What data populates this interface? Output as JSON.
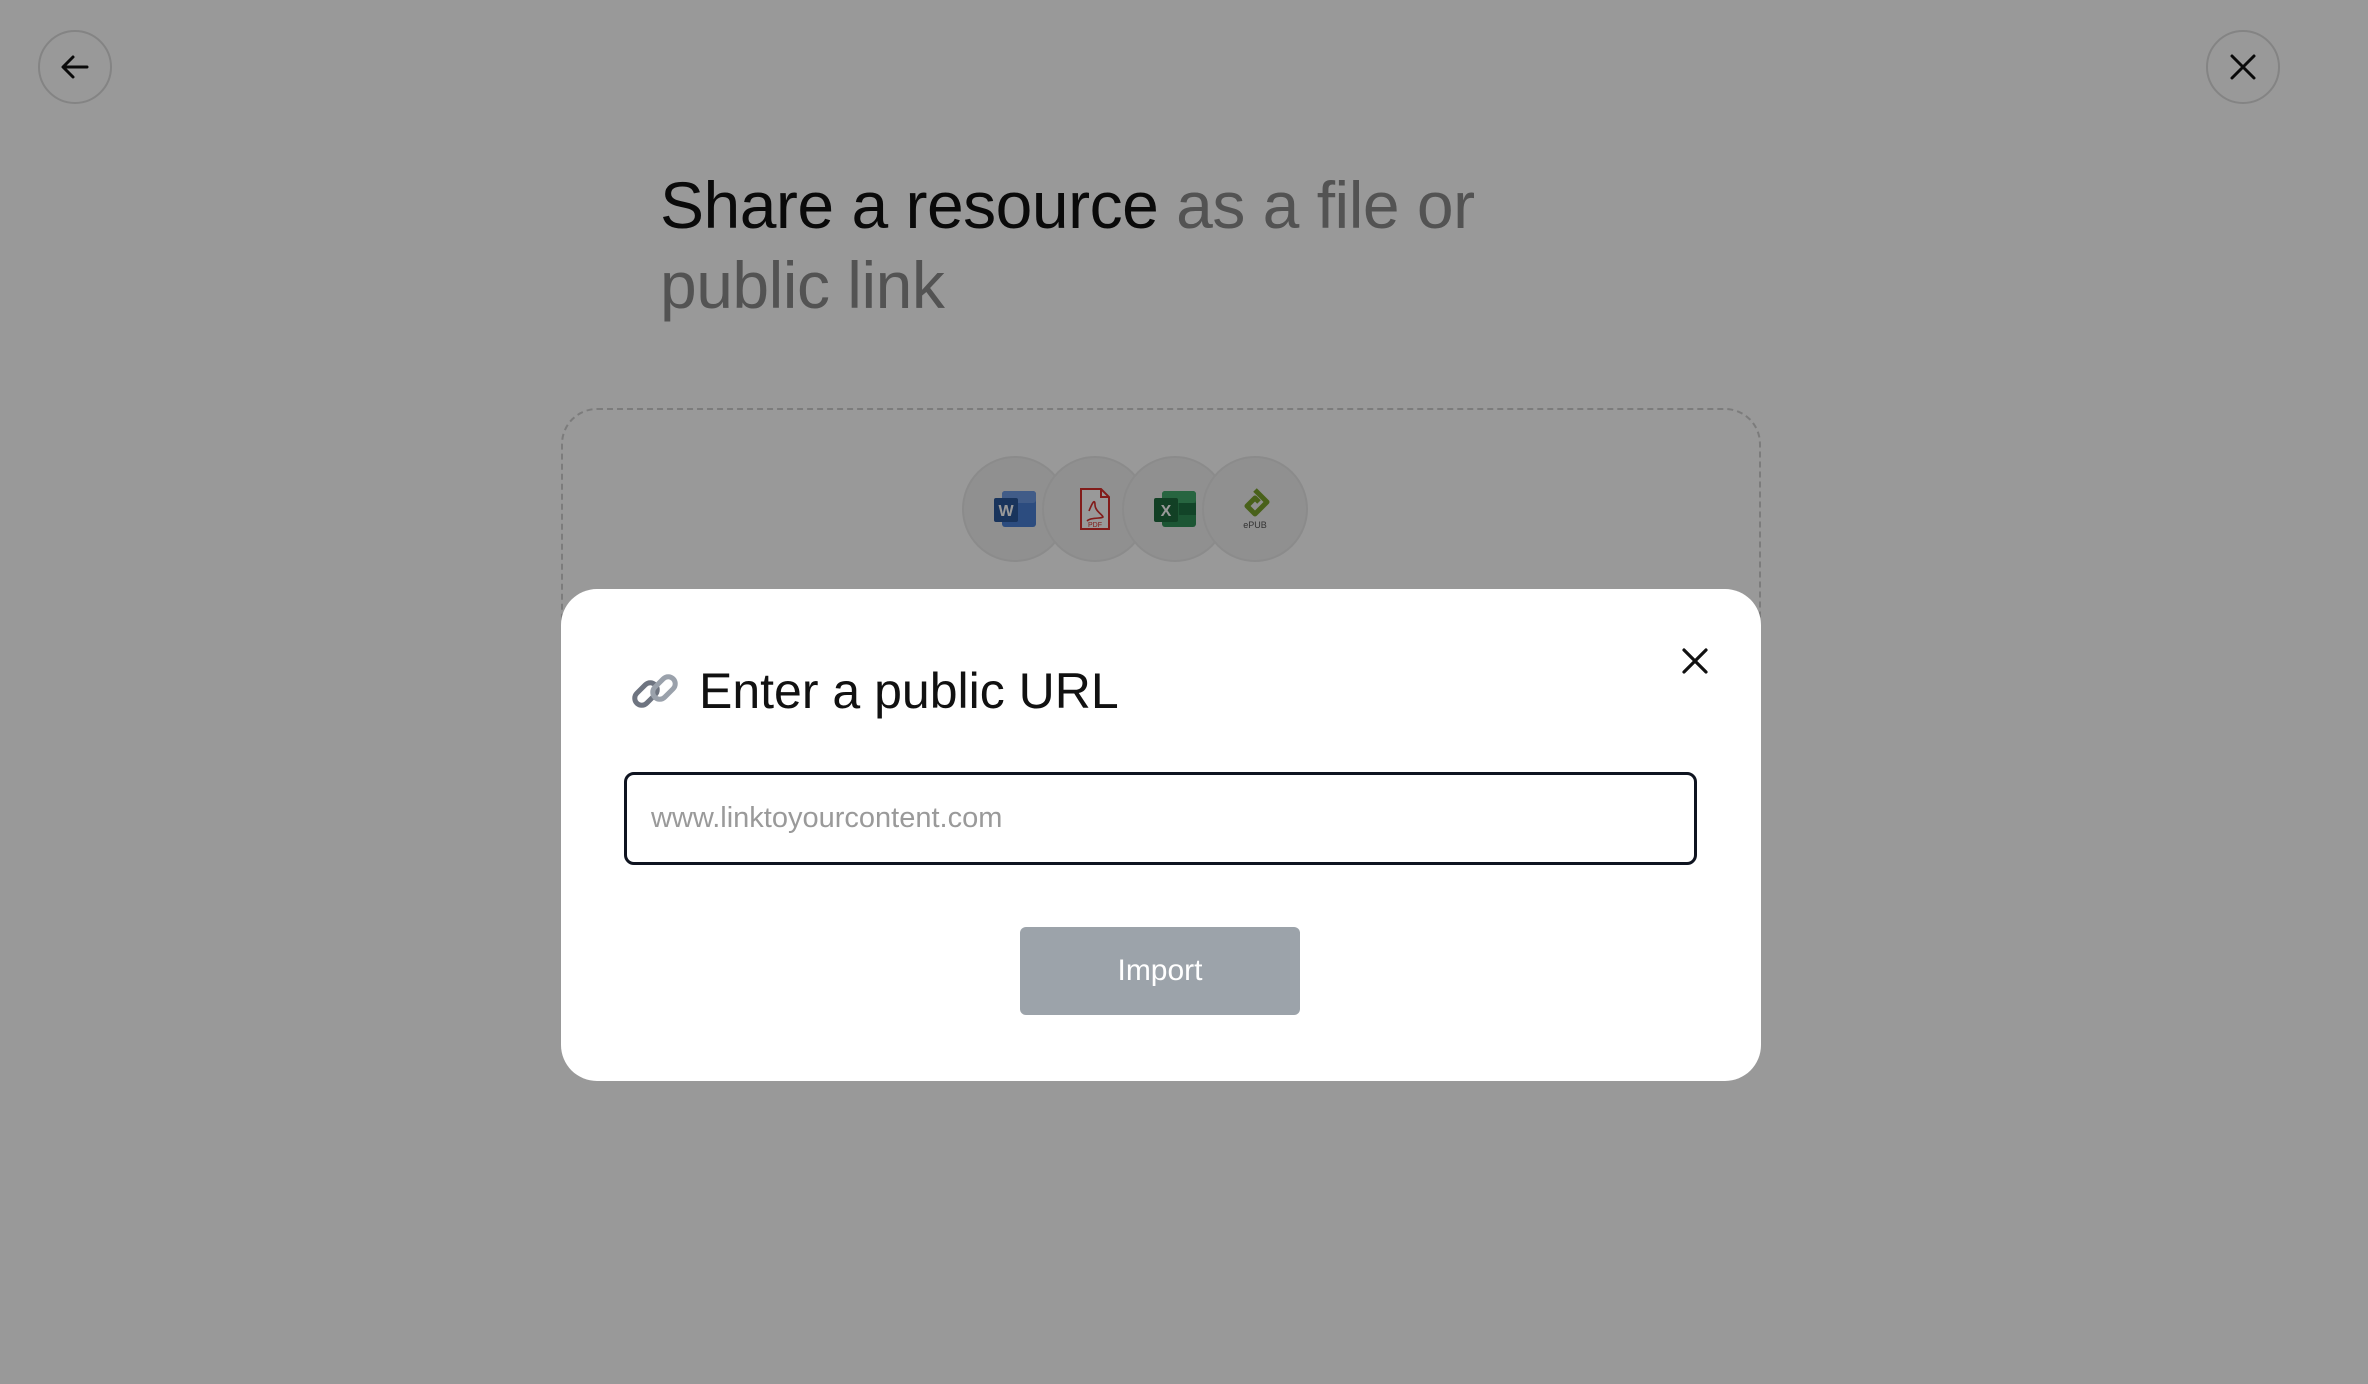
{
  "page": {
    "headline_strong": "Share a resource",
    "headline_muted": " as a file or public link",
    "file_types": [
      {
        "name": "word-icon",
        "label": "W"
      },
      {
        "name": "pdf-icon",
        "label": "PDF"
      },
      {
        "name": "excel-icon",
        "label": "X"
      },
      {
        "name": "epub-icon",
        "label": "ePUB"
      }
    ]
  },
  "modal": {
    "title": "Enter a public URL",
    "url_placeholder": "www.linktoyourcontent.com",
    "url_value": "",
    "import_label": "Import"
  },
  "colors": {
    "overlay": "rgba(0,0,0,0.40)",
    "import_disabled": "#9ca3aa",
    "input_border": "#0f1420",
    "word": "#2b579a",
    "pdf": "#d9302c",
    "excel": "#1f7244",
    "epub": "#7aa22c"
  }
}
